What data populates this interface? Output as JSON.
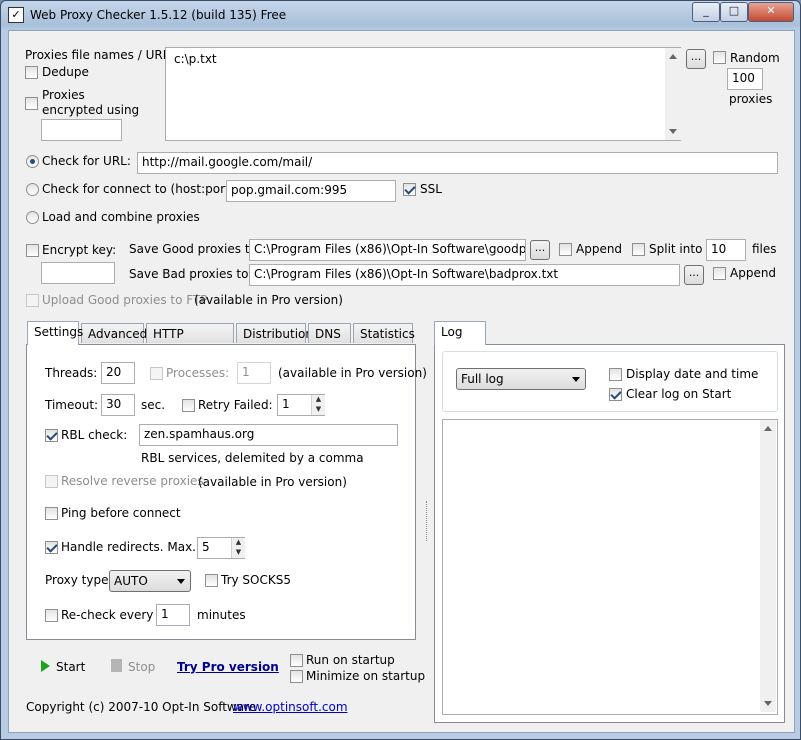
{
  "window": {
    "title": "Web Proxy Checker 1.5.12 (build 135) Free",
    "minimize": "_",
    "maximize": "□",
    "close": "✕"
  },
  "source": {
    "files_label": "Proxies file names / URLs:",
    "files_value": "c:\\p.txt",
    "dedupe": "Dedupe",
    "encrypted_label": "Proxies encrypted using the key:",
    "encrypted_key": "",
    "browse": "...",
    "random": "Random",
    "random_count": "100",
    "proxies": "proxies"
  },
  "mode": {
    "check_url_label": "Check for URL:",
    "check_url_value": "http://mail.google.com/mail/",
    "check_connect_label": "Check for connect to (host:port):",
    "check_connect_value": "pop.gmail.com:995",
    "ssl": "SSL",
    "load_combine": "Load and combine proxies"
  },
  "output": {
    "encrypt_key": "Encrypt key:",
    "encrypt_key_value": "",
    "save_good_label": "Save Good proxies to:",
    "save_good_value": "C:\\Program Files (x86)\\Opt-In Software\\goodprox.txt",
    "save_bad_label": "Save Bad proxies to:",
    "save_bad_value": "C:\\Program Files (x86)\\Opt-In Software\\badprox.txt",
    "browse": "...",
    "append": "Append",
    "split_into": "Split into",
    "split_count": "10",
    "files": "files",
    "upload_ftp": "Upload Good proxies to FTP",
    "upload_note": "(available in Pro version)"
  },
  "tabs": [
    "Settings",
    "Advanced",
    "HTTP Headers",
    "Distribution",
    "DNS",
    "Statistics"
  ],
  "settings": {
    "threads_label": "Threads:",
    "threads_value": "20",
    "processes_label": "Processes:",
    "processes_value": "1",
    "processes_note": "(available in Pro version)",
    "timeout_label": "Timeout:",
    "timeout_value": "30",
    "timeout_unit": "sec.",
    "retry_label": "Retry Failed:",
    "retry_value": "1",
    "rbl_label": "RBL check:",
    "rbl_value": "zen.spamhaus.org",
    "rbl_hint": "RBL services, delemited by a comma",
    "resolve_label": "Resolve reverse proxies",
    "resolve_note": "(available in Pro version)",
    "ping_label": "Ping before connect",
    "redirects_label": "Handle redirects. Max.:",
    "redirects_value": "5",
    "proxy_type_label": "Proxy type:",
    "proxy_type_value": "AUTO",
    "try_socks5": "Try SOCKS5",
    "recheck_label": "Re-check every",
    "recheck_value": "1",
    "recheck_unit": "minutes"
  },
  "actions": {
    "start": "Start",
    "stop": "Stop",
    "try_pro": "Try Pro version",
    "run_on_startup": "Run on startup",
    "minimize_on_startup": "Minimize on startup"
  },
  "log": {
    "tab": "Log",
    "level": "Full log",
    "display_datetime": "Display date and time",
    "clear_on_start": "Clear log on Start"
  },
  "footer": {
    "copyright": "Copyright (c) 2007-10 Opt-In Software",
    "website": "www.optinsoft.com"
  }
}
